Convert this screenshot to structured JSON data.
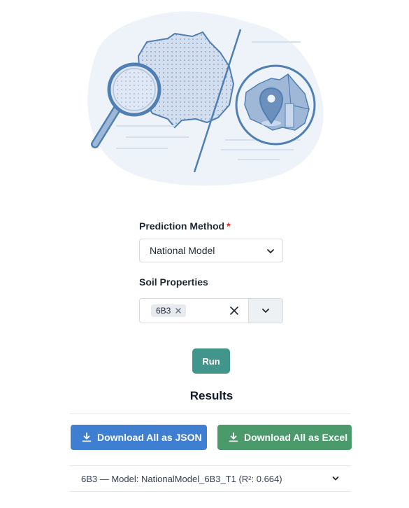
{
  "form": {
    "method_label": "Prediction Method",
    "required_mark": "*",
    "method_value": "National Model",
    "soil_label": "Soil Properties",
    "soil_tags": [
      "6B3"
    ]
  },
  "actions": {
    "run_label": "Run"
  },
  "results": {
    "title": "Results",
    "download_json_label": "Download All as JSON",
    "download_excel_label": "Download All as Excel",
    "items": [
      {
        "label": "6B3 — Model: NationalModel_6B3_T1 (R²: 0.664)"
      }
    ]
  },
  "colors": {
    "run": "#41958b",
    "json_button": "#3f7fd1",
    "excel_button": "#4b9a6c",
    "required": "#dc2626",
    "illustration_blue": "#4f7fb3"
  },
  "icons": [
    "magnifier-australia-illustration",
    "chevron-down-icon",
    "close-icon",
    "download-icon",
    "map-pin-icon"
  ]
}
